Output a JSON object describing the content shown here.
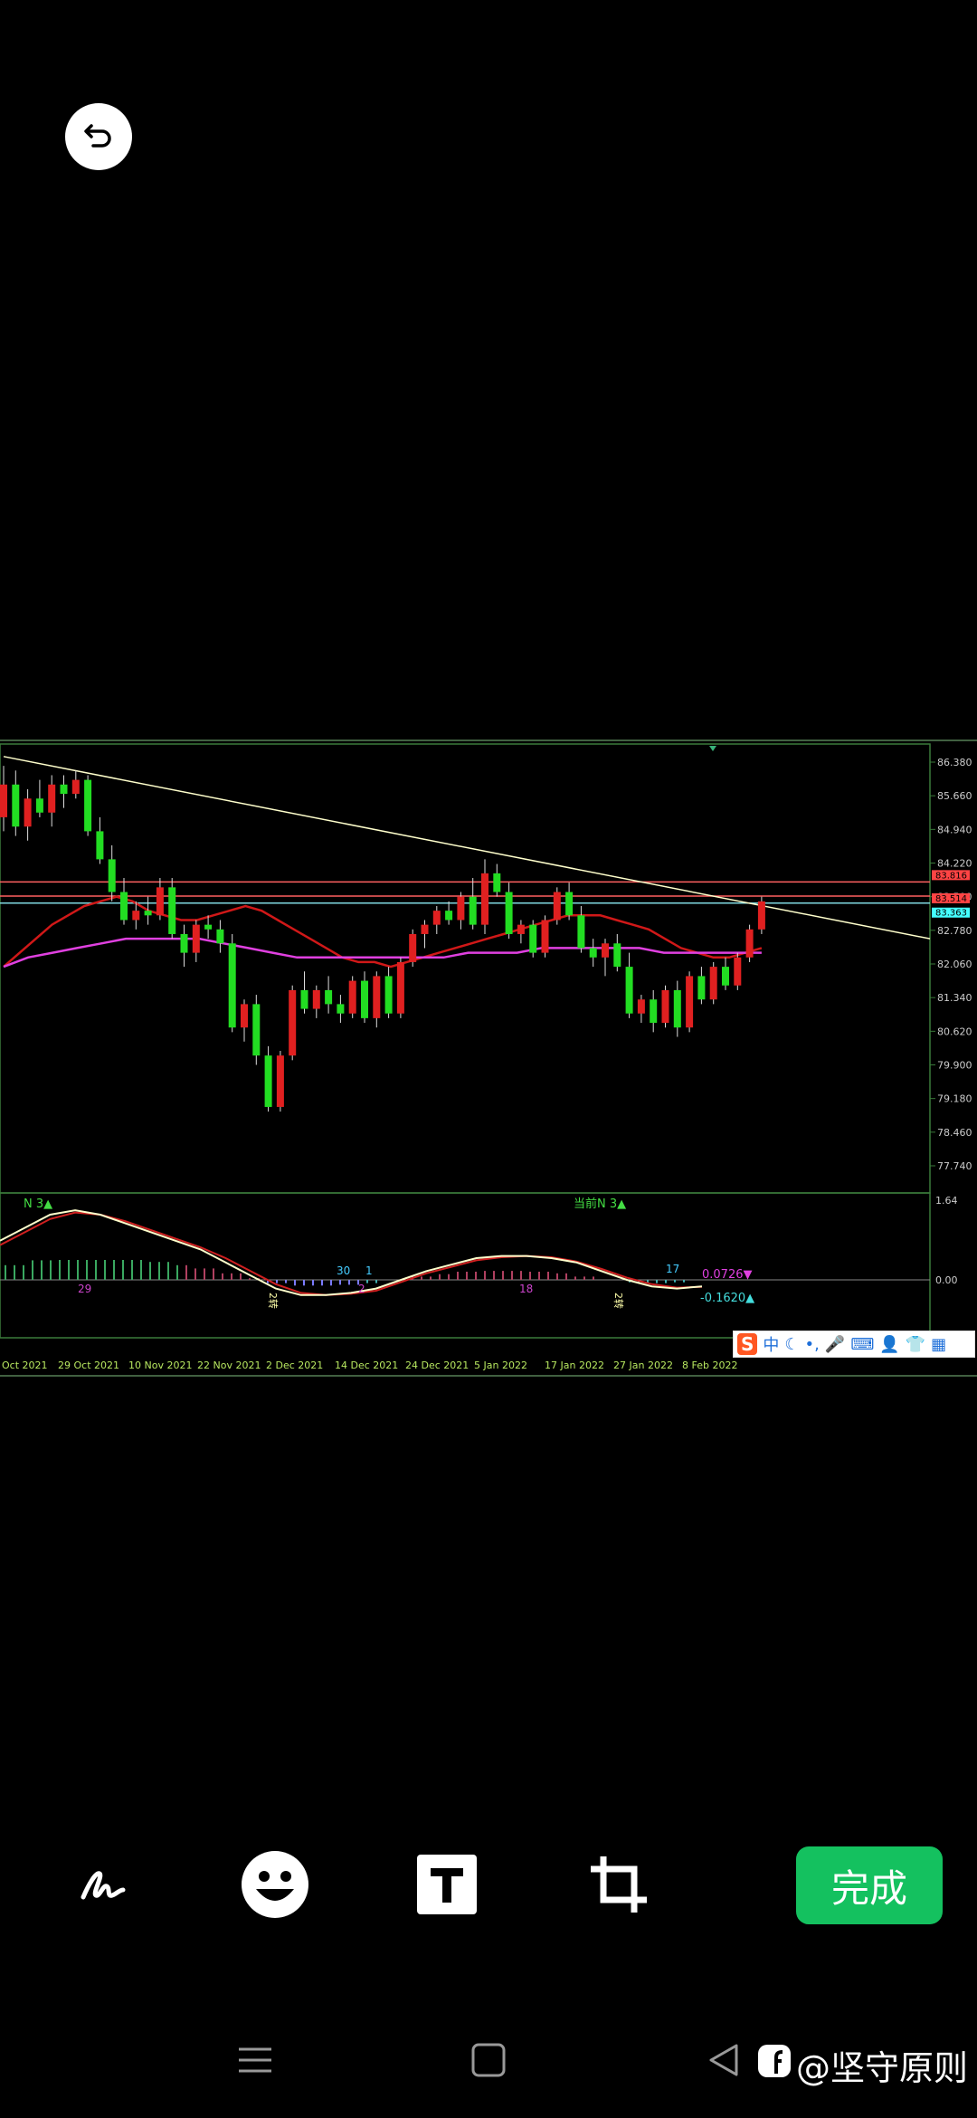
{
  "editor": {
    "undo_icon": "undo-icon",
    "done_label": "完成",
    "tools": [
      {
        "name": "draw-tool",
        "icon": "pen-scribble-icon"
      },
      {
        "name": "sticker-tool",
        "icon": "smiley-icon"
      },
      {
        "name": "text-tool",
        "icon": "text-T-icon"
      },
      {
        "name": "crop-tool",
        "icon": "crop-icon"
      }
    ],
    "accent_color": "#14c15f"
  },
  "nav": {
    "menu_icon": "menu-icon",
    "home_icon": "home-square-icon",
    "back_icon": "back-triangle-icon",
    "watermark": "@坚守原则"
  },
  "ime": {
    "logo": "S",
    "items": [
      "中",
      "☾",
      "•,",
      "🎤",
      "⌨",
      "👤",
      "👕",
      "▦"
    ]
  },
  "chart_data": {
    "type": "candlestick",
    "title": "",
    "price_axis": {
      "ticks": [
        "86.380",
        "85.660",
        "84.940",
        "84.220",
        "83.500",
        "82.780",
        "82.060",
        "81.340",
        "80.620",
        "79.900",
        "79.180",
        "78.460",
        "77.740"
      ],
      "price_labels": [
        {
          "text": "83.816",
          "color": "#ff4444"
        },
        {
          "text": "83.514",
          "color": "#ff4444"
        },
        {
          "text": "83.363",
          "color": "#44ffff"
        }
      ]
    },
    "date_axis": [
      "Oct 2021",
      "29 Oct 2021",
      "10 Nov 2021",
      "22 Nov 2021",
      "2 Dec 2021",
      "14 Dec 2021",
      "24 Dec 2021",
      "5 Jan 2022",
      "17 Jan 2022",
      "27 Jan 2022",
      "8 Feb 2022"
    ],
    "ylim": [
      77.74,
      86.38
    ],
    "candles": [
      {
        "o": 85.2,
        "h": 86.3,
        "l": 84.9,
        "c": 85.9
      },
      {
        "o": 85.9,
        "h": 86.2,
        "l": 84.8,
        "c": 85.0
      },
      {
        "o": 85.0,
        "h": 85.8,
        "l": 84.7,
        "c": 85.6
      },
      {
        "o": 85.6,
        "h": 86.0,
        "l": 85.2,
        "c": 85.3
      },
      {
        "o": 85.3,
        "h": 86.1,
        "l": 85.0,
        "c": 85.9
      },
      {
        "o": 85.9,
        "h": 86.1,
        "l": 85.4,
        "c": 85.7
      },
      {
        "o": 85.7,
        "h": 86.2,
        "l": 85.6,
        "c": 86.0
      },
      {
        "o": 86.0,
        "h": 86.1,
        "l": 84.8,
        "c": 84.9
      },
      {
        "o": 84.9,
        "h": 85.2,
        "l": 84.2,
        "c": 84.3
      },
      {
        "o": 84.3,
        "h": 84.6,
        "l": 83.4,
        "c": 83.6
      },
      {
        "o": 83.6,
        "h": 83.9,
        "l": 82.9,
        "c": 83.0
      },
      {
        "o": 83.0,
        "h": 83.4,
        "l": 82.8,
        "c": 83.2
      },
      {
        "o": 83.2,
        "h": 83.5,
        "l": 82.9,
        "c": 83.1
      },
      {
        "o": 83.1,
        "h": 83.9,
        "l": 83.0,
        "c": 83.7
      },
      {
        "o": 83.7,
        "h": 83.9,
        "l": 82.6,
        "c": 82.7
      },
      {
        "o": 82.7,
        "h": 82.9,
        "l": 82.0,
        "c": 82.3
      },
      {
        "o": 82.3,
        "h": 83.0,
        "l": 82.1,
        "c": 82.9
      },
      {
        "o": 82.9,
        "h": 83.1,
        "l": 82.6,
        "c": 82.8
      },
      {
        "o": 82.8,
        "h": 83.0,
        "l": 82.3,
        "c": 82.5
      },
      {
        "o": 82.5,
        "h": 82.7,
        "l": 80.6,
        "c": 80.7
      },
      {
        "o": 80.7,
        "h": 81.3,
        "l": 80.4,
        "c": 81.2
      },
      {
        "o": 81.2,
        "h": 81.4,
        "l": 79.9,
        "c": 80.1
      },
      {
        "o": 80.1,
        "h": 80.3,
        "l": 78.9,
        "c": 79.0
      },
      {
        "o": 79.0,
        "h": 80.2,
        "l": 78.9,
        "c": 80.1
      },
      {
        "o": 80.1,
        "h": 81.6,
        "l": 80.0,
        "c": 81.5
      },
      {
        "o": 81.5,
        "h": 81.9,
        "l": 81.0,
        "c": 81.1
      },
      {
        "o": 81.1,
        "h": 81.6,
        "l": 80.9,
        "c": 81.5
      },
      {
        "o": 81.5,
        "h": 81.8,
        "l": 81.0,
        "c": 81.2
      },
      {
        "o": 81.2,
        "h": 81.4,
        "l": 80.8,
        "c": 81.0
      },
      {
        "o": 81.0,
        "h": 81.8,
        "l": 80.9,
        "c": 81.7
      },
      {
        "o": 81.7,
        "h": 81.9,
        "l": 80.8,
        "c": 80.9
      },
      {
        "o": 80.9,
        "h": 81.9,
        "l": 80.7,
        "c": 81.8
      },
      {
        "o": 81.8,
        "h": 82.0,
        "l": 80.9,
        "c": 81.0
      },
      {
        "o": 81.0,
        "h": 82.2,
        "l": 80.9,
        "c": 82.1
      },
      {
        "o": 82.1,
        "h": 82.8,
        "l": 82.0,
        "c": 82.7
      },
      {
        "o": 82.7,
        "h": 83.0,
        "l": 82.4,
        "c": 82.9
      },
      {
        "o": 82.9,
        "h": 83.3,
        "l": 82.7,
        "c": 83.2
      },
      {
        "o": 83.2,
        "h": 83.4,
        "l": 82.9,
        "c": 83.0
      },
      {
        "o": 83.0,
        "h": 83.6,
        "l": 82.8,
        "c": 83.5
      },
      {
        "o": 83.5,
        "h": 83.9,
        "l": 82.8,
        "c": 82.9
      },
      {
        "o": 82.9,
        "h": 84.3,
        "l": 82.7,
        "c": 84.0
      },
      {
        "o": 84.0,
        "h": 84.2,
        "l": 83.5,
        "c": 83.6
      },
      {
        "o": 83.6,
        "h": 83.8,
        "l": 82.6,
        "c": 82.7
      },
      {
        "o": 82.7,
        "h": 83.0,
        "l": 82.5,
        "c": 82.9
      },
      {
        "o": 82.9,
        "h": 83.0,
        "l": 82.2,
        "c": 82.3
      },
      {
        "o": 82.3,
        "h": 83.1,
        "l": 82.2,
        "c": 83.0
      },
      {
        "o": 83.0,
        "h": 83.7,
        "l": 82.9,
        "c": 83.6
      },
      {
        "o": 83.6,
        "h": 83.8,
        "l": 83.0,
        "c": 83.1
      },
      {
        "o": 83.1,
        "h": 83.3,
        "l": 82.3,
        "c": 82.4
      },
      {
        "o": 82.4,
        "h": 82.6,
        "l": 82.0,
        "c": 82.2
      },
      {
        "o": 82.2,
        "h": 82.6,
        "l": 81.8,
        "c": 82.5
      },
      {
        "o": 82.5,
        "h": 82.7,
        "l": 81.9,
        "c": 82.0
      },
      {
        "o": 82.0,
        "h": 82.3,
        "l": 80.9,
        "c": 81.0
      },
      {
        "o": 81.0,
        "h": 81.4,
        "l": 80.8,
        "c": 81.3
      },
      {
        "o": 81.3,
        "h": 81.5,
        "l": 80.6,
        "c": 80.8
      },
      {
        "o": 80.8,
        "h": 81.6,
        "l": 80.7,
        "c": 81.5
      },
      {
        "o": 81.5,
        "h": 81.7,
        "l": 80.5,
        "c": 80.7
      },
      {
        "o": 80.7,
        "h": 81.9,
        "l": 80.6,
        "c": 81.8
      },
      {
        "o": 81.8,
        "h": 82.0,
        "l": 81.2,
        "c": 81.3
      },
      {
        "o": 81.3,
        "h": 82.1,
        "l": 81.2,
        "c": 82.0
      },
      {
        "o": 82.0,
        "h": 82.2,
        "l": 81.5,
        "c": 81.6
      },
      {
        "o": 81.6,
        "h": 82.3,
        "l": 81.5,
        "c": 82.2
      },
      {
        "o": 82.2,
        "h": 82.9,
        "l": 82.1,
        "c": 82.8
      },
      {
        "o": 82.8,
        "h": 83.5,
        "l": 82.7,
        "c": 83.4
      }
    ],
    "trendline": {
      "from": {
        "i": 0,
        "price": 86.5
      },
      "to": {
        "i": 74,
        "price": 82.6
      },
      "color": "#ffffcc"
    },
    "horizontal_lines": [
      {
        "price": 83.816,
        "color": "#ff6060"
      },
      {
        "price": 83.514,
        "color": "#ff6060"
      },
      {
        "price": 83.363,
        "color": "#7fd8e0"
      }
    ],
    "ma_red": [
      82.0,
      82.3,
      82.6,
      82.9,
      83.1,
      83.3,
      83.4,
      83.5,
      83.4,
      83.2,
      83.1,
      83.0,
      83.0,
      83.1,
      83.2,
      83.3,
      83.2,
      83.0,
      82.8,
      82.6,
      82.4,
      82.2,
      82.1,
      82.1,
      82.0,
      82.1,
      82.2,
      82.3,
      82.4,
      82.5,
      82.6,
      82.7,
      82.8,
      82.9,
      83.0,
      83.1,
      83.1,
      83.1,
      83.0,
      82.9,
      82.8,
      82.6,
      82.4,
      82.3,
      82.2,
      82.2,
      82.3,
      82.4
    ],
    "ma_magenta": [
      82.0,
      82.2,
      82.3,
      82.4,
      82.5,
      82.6,
      82.6,
      82.6,
      82.6,
      82.5,
      82.4,
      82.3,
      82.2,
      82.2,
      82.2,
      82.2,
      82.2,
      82.2,
      82.2,
      82.3,
      82.3,
      82.3,
      82.4,
      82.4,
      82.4,
      82.4,
      82.4,
      82.3,
      82.3,
      82.3,
      82.3,
      82.3
    ],
    "indicator": {
      "label_left": "N 3▲",
      "label_center": "当前N 3▲",
      "top_value": "1.64",
      "zero_label": "0.00",
      "value_magenta": "0.0726▼",
      "value_cyan": "-0.1620▲",
      "counts": [
        {
          "text": "29",
          "color": "#cc44cc"
        },
        {
          "text": "30",
          "color": "#44ccff"
        },
        {
          "text": "1",
          "color": "#44ccff"
        },
        {
          "text": "2",
          "color": "#cc44cc"
        },
        {
          "text": "18",
          "color": "#cc44cc"
        },
        {
          "text": "17",
          "color": "#44ccff"
        }
      ],
      "vertical_labels": [
        "2转",
        "2转"
      ],
      "line_white": [
        0.9,
        1.2,
        1.5,
        1.6,
        1.5,
        1.3,
        1.1,
        0.9,
        0.7,
        0.4,
        0.1,
        -0.2,
        -0.35,
        -0.35,
        -0.3,
        -0.2,
        0.0,
        0.2,
        0.35,
        0.5,
        0.55,
        0.55,
        0.5,
        0.4,
        0.2,
        0.0,
        -0.15,
        -0.2,
        -0.15
      ],
      "line_red": [
        0.8,
        1.1,
        1.4,
        1.55,
        1.5,
        1.35,
        1.15,
        0.95,
        0.75,
        0.5,
        0.2,
        -0.1,
        -0.3,
        -0.35,
        -0.32,
        -0.25,
        -0.05,
        0.15,
        0.3,
        0.45,
        0.52,
        0.55,
        0.52,
        0.42,
        0.25,
        0.05,
        -0.1,
        -0.18,
        -0.16
      ]
    }
  }
}
